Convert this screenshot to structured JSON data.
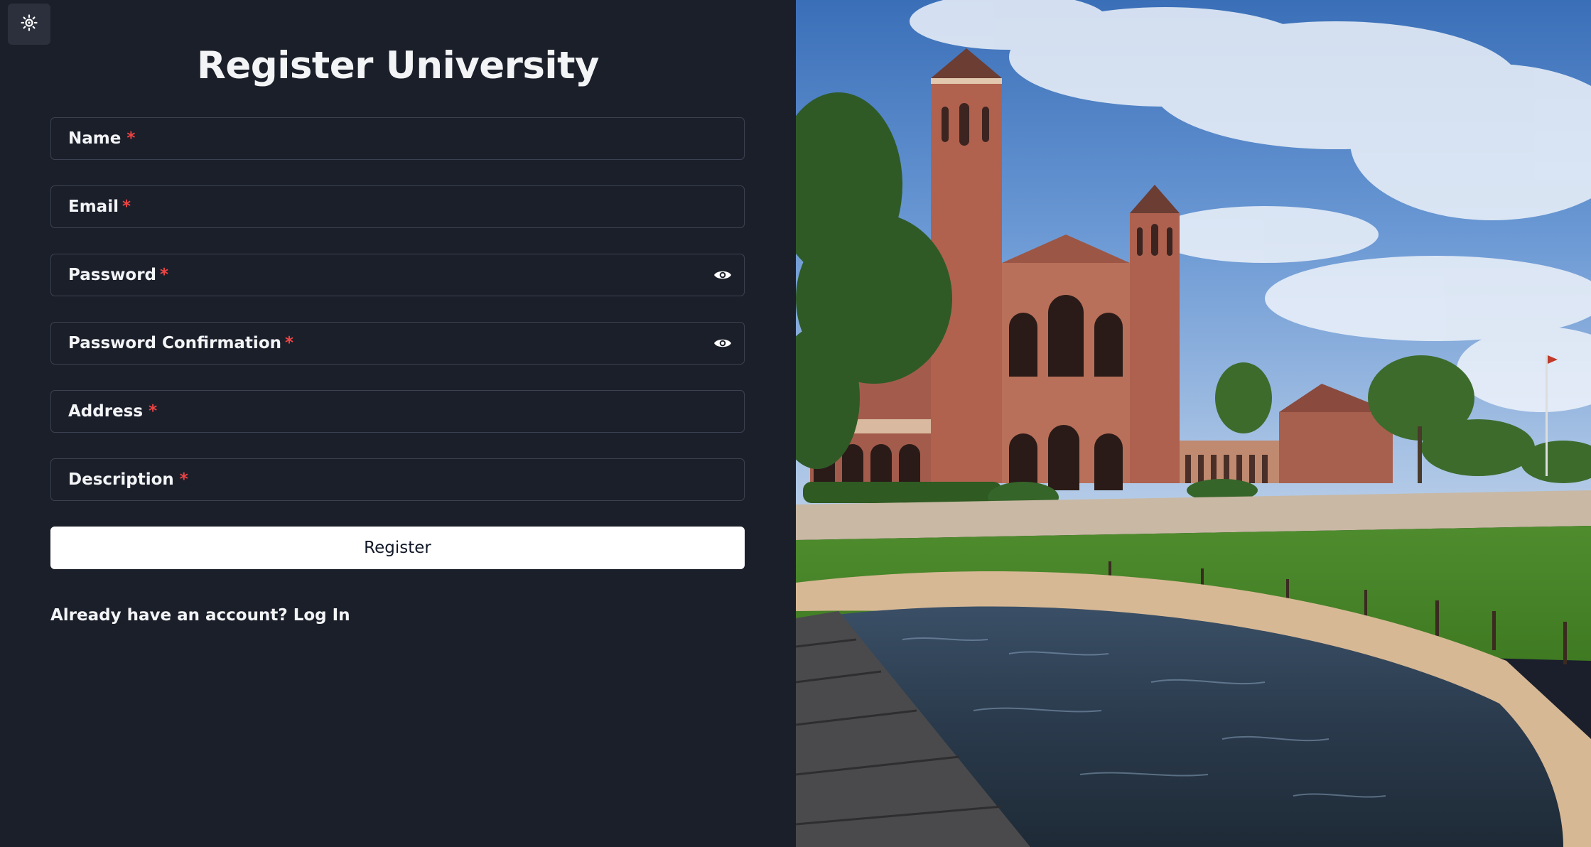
{
  "page": {
    "title": "Register University"
  },
  "theme_toggle": {
    "icon": "sun-icon"
  },
  "form": {
    "fields": [
      {
        "label": "Name",
        "required_mark": "*",
        "type": "text",
        "value": ""
      },
      {
        "label": "Email",
        "required_mark": "*",
        "type": "email",
        "value": ""
      },
      {
        "label": "Password",
        "required_mark": "*",
        "type": "password",
        "value": "",
        "icon": "eye-icon"
      },
      {
        "label": "Password Confirmation",
        "required_mark": "*",
        "type": "password",
        "value": "",
        "icon": "eye-icon"
      },
      {
        "label": "Address",
        "required_mark": "*",
        "type": "text",
        "value": ""
      },
      {
        "label": "Description",
        "required_mark": "*",
        "type": "text",
        "value": ""
      }
    ],
    "submit_label": "Register"
  },
  "login_prompt": {
    "text": "Already have an account?",
    "link_label": "Log In"
  },
  "hero_image": {
    "subject": "university-campus-photo"
  },
  "colors": {
    "background": "#1b1f2a",
    "field_border": "#3b4150",
    "text": "#f3f4f6",
    "required": "#ef4444",
    "button_bg": "#ffffff",
    "button_text": "#111827"
  }
}
